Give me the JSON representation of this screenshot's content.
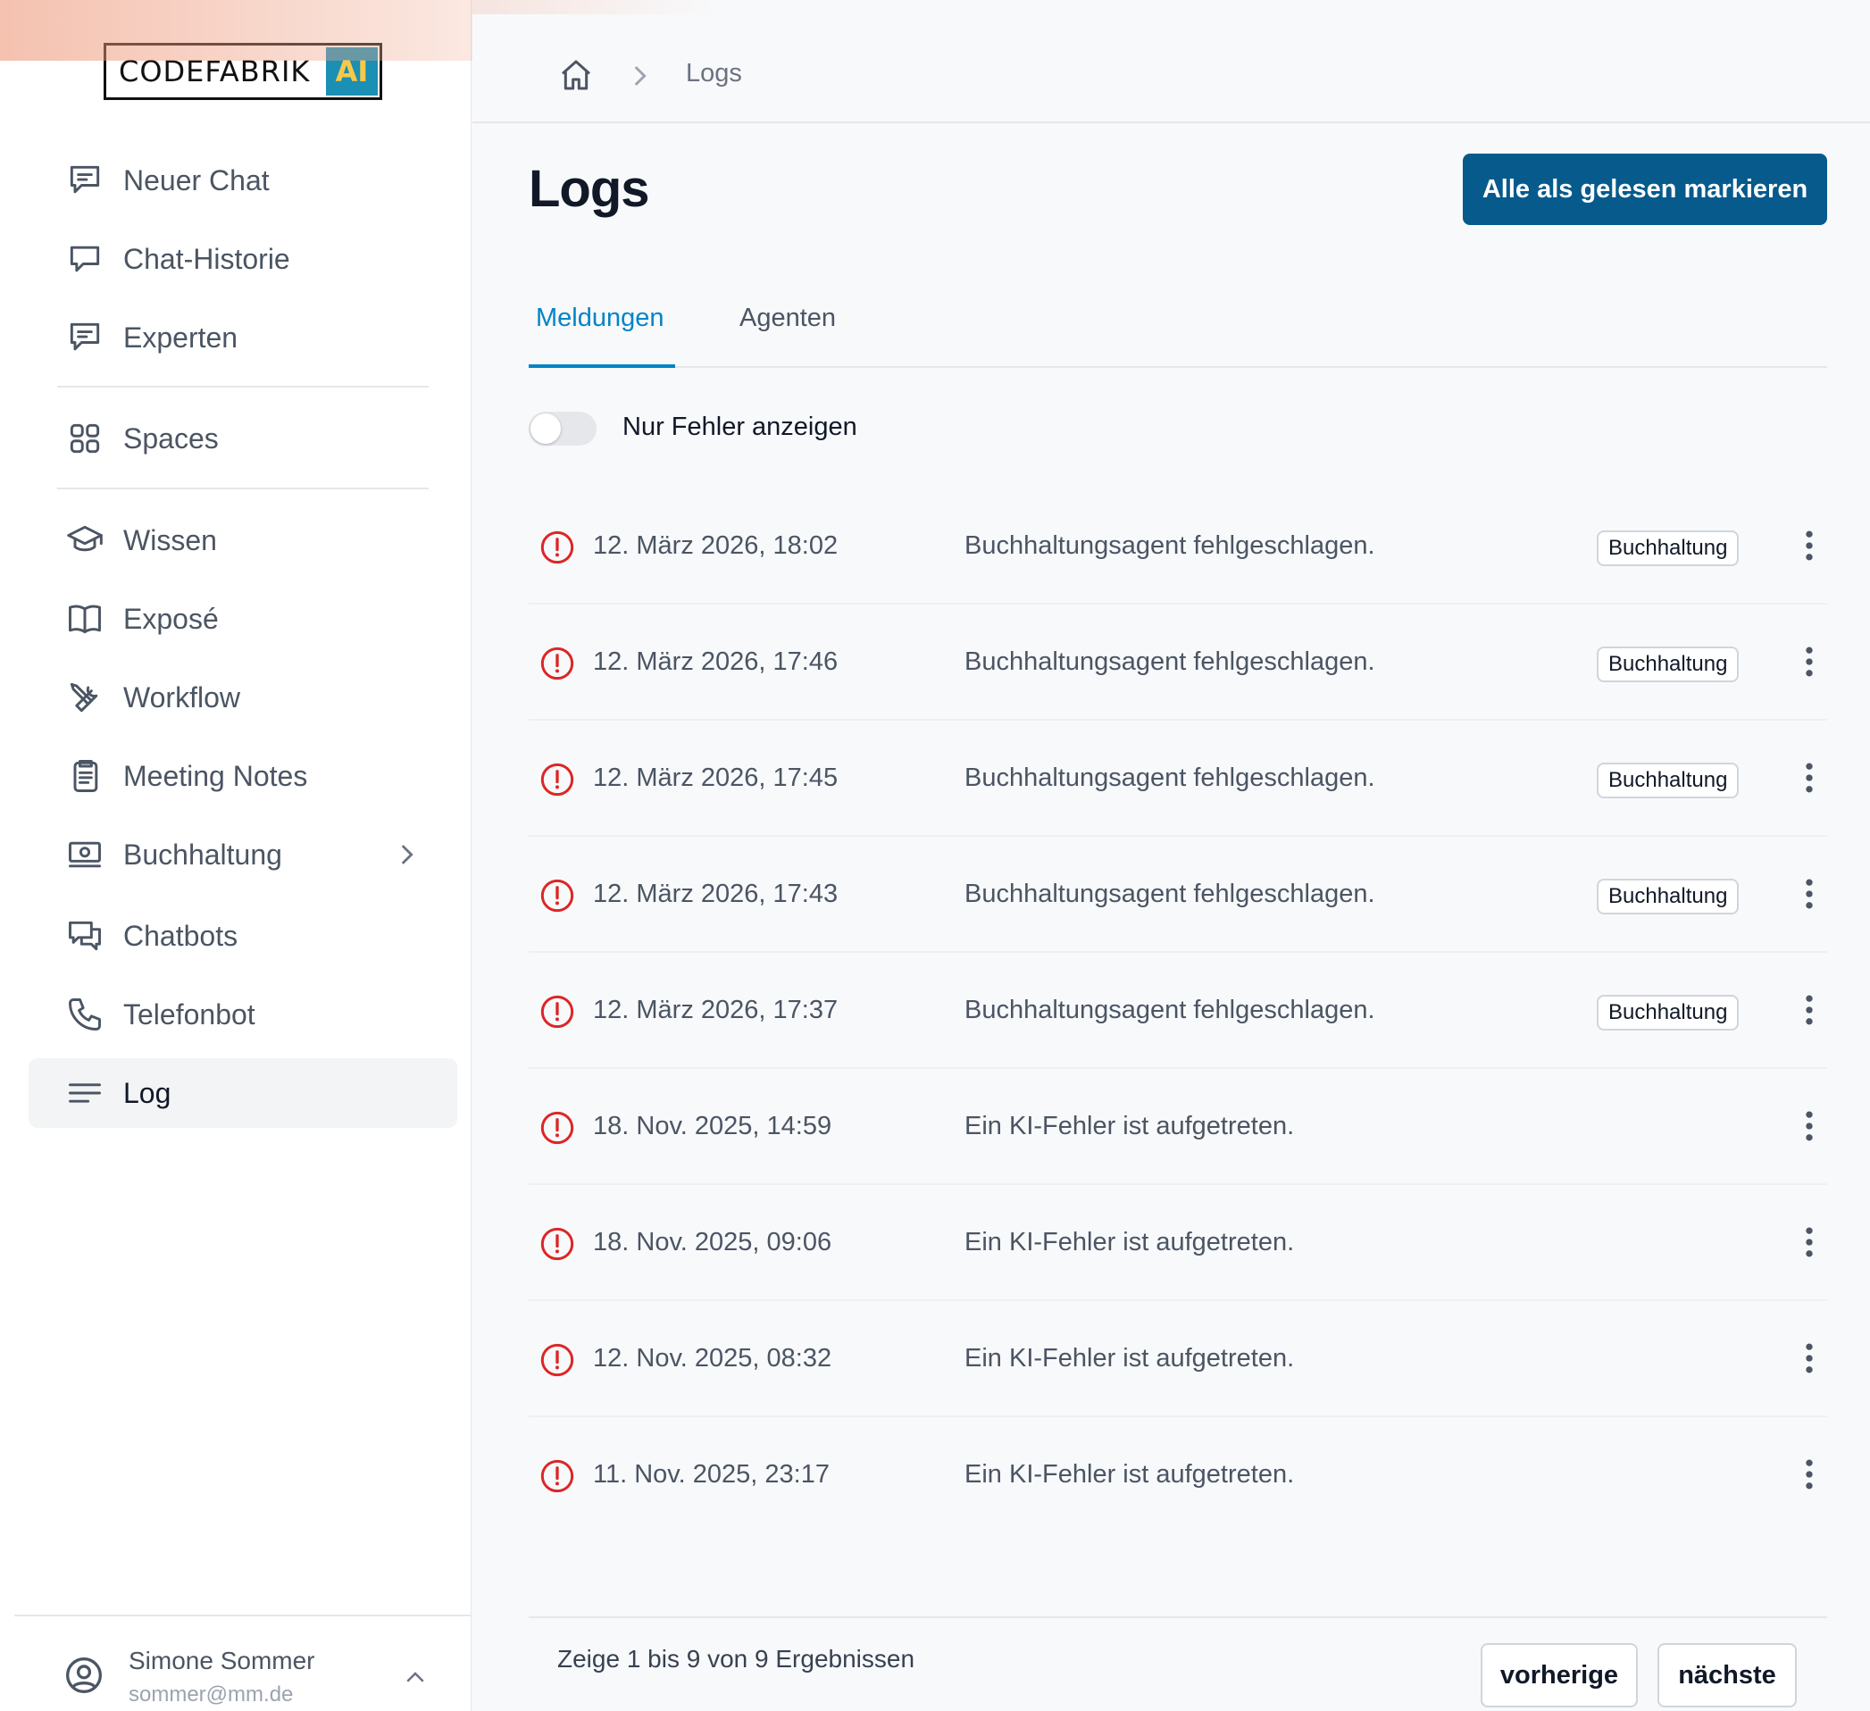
{
  "brand": {
    "name": "CODEFABRIK",
    "ai_badge": "AI"
  },
  "sidebar": {
    "items": [
      {
        "label": "Neuer Chat",
        "icon": "chat-bubble-icon"
      },
      {
        "label": "Chat-Historie",
        "icon": "chat-history-icon"
      },
      {
        "label": "Experten",
        "icon": "experts-chat-icon"
      },
      {
        "label": "Spaces",
        "icon": "grid-icon"
      },
      {
        "label": "Wissen",
        "icon": "graduation-cap-icon"
      },
      {
        "label": "Exposé",
        "icon": "book-open-icon"
      },
      {
        "label": "Workflow",
        "icon": "tools-icon"
      },
      {
        "label": "Meeting Notes",
        "icon": "clipboard-icon"
      },
      {
        "label": "Buchhaltung",
        "icon": "cash-icon"
      },
      {
        "label": "Chatbots",
        "icon": "chatbots-icon"
      },
      {
        "label": "Telefonbot",
        "icon": "phone-icon"
      },
      {
        "label": "Log",
        "icon": "list-icon"
      }
    ],
    "active": "Log"
  },
  "user": {
    "name": "Simone Sommer",
    "email": "sommer@mm.de"
  },
  "breadcrumb": {
    "current": "Logs"
  },
  "page": {
    "title": "Logs",
    "mark_all_read": "Alle als gelesen markieren"
  },
  "tabs": [
    {
      "label": "Meldungen",
      "active": true
    },
    {
      "label": "Agenten",
      "active": false
    }
  ],
  "filter": {
    "label": "Nur Fehler anzeigen",
    "enabled": false
  },
  "logs": [
    {
      "date": "12. März 2026, 18:02",
      "message": "Buchhaltungsagent fehlgeschlagen.",
      "tag": "Buchhaltung"
    },
    {
      "date": "12. März 2026, 17:46",
      "message": "Buchhaltungsagent fehlgeschlagen.",
      "tag": "Buchhaltung"
    },
    {
      "date": "12. März 2026, 17:45",
      "message": "Buchhaltungsagent fehlgeschlagen.",
      "tag": "Buchhaltung"
    },
    {
      "date": "12. März 2026, 17:43",
      "message": "Buchhaltungsagent fehlgeschlagen.",
      "tag": "Buchhaltung"
    },
    {
      "date": "12. März 2026, 17:37",
      "message": "Buchhaltungsagent fehlgeschlagen.",
      "tag": "Buchhaltung"
    },
    {
      "date": "18. Nov. 2025, 14:59",
      "message": "Ein KI-Fehler ist aufgetreten.",
      "tag": ""
    },
    {
      "date": "18. Nov. 2025, 09:06",
      "message": "Ein KI-Fehler ist aufgetreten.",
      "tag": ""
    },
    {
      "date": "12. Nov. 2025, 08:32",
      "message": "Ein KI-Fehler ist aufgetreten.",
      "tag": ""
    },
    {
      "date": "11. Nov. 2025, 23:17",
      "message": "Ein KI-Fehler ist aufgetreten.",
      "tag": ""
    }
  ],
  "pagination": {
    "summary": "Zeige 1 bis 9 von 9 Ergebnissen",
    "prev": "vorherige",
    "next": "nächste"
  },
  "colors": {
    "primary": "#065a8c",
    "accent": "#0284c7",
    "error": "#dc2626"
  }
}
